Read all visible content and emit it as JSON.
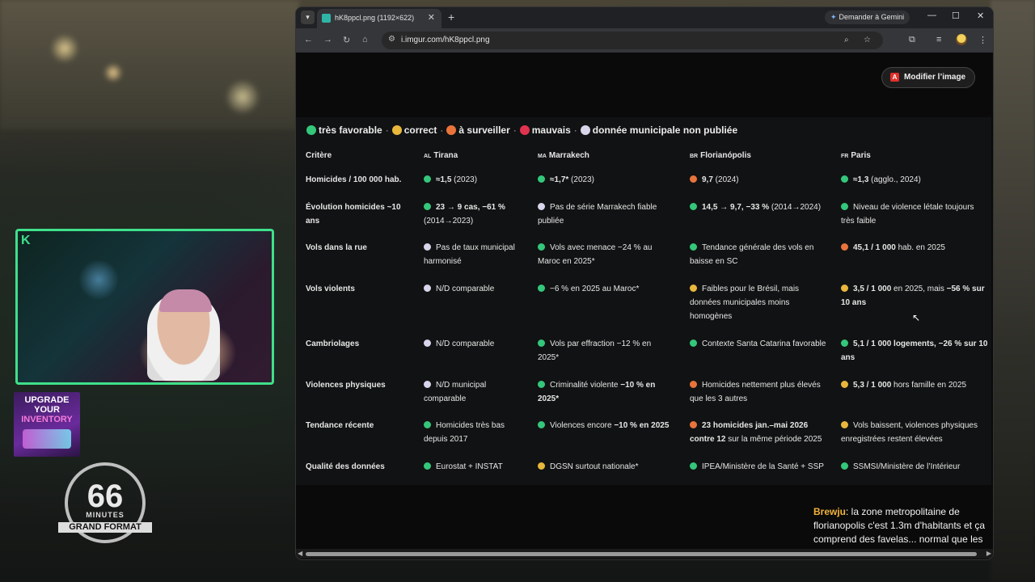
{
  "overlay": {
    "ad": {
      "line1": "UPGRADE",
      "line2": "YOUR",
      "line3": "INVENTORY"
    },
    "logo": {
      "number": "66",
      "minutes": "MINUTES",
      "grand_format": "GRAND FORMAT"
    },
    "webcam_badge": "K"
  },
  "browser": {
    "tab_title": "hK8ppcl.png (1192×622)",
    "tab_close": "✕",
    "new_tab": "+",
    "gemini_label": "Demander à Gemini",
    "url": "i.imgur.com/hK8ppcl.png",
    "window_controls": {
      "minimize": "—",
      "maximize": "☐",
      "close": "✕"
    }
  },
  "page": {
    "edit_button": "Modifier l’image",
    "legend": [
      {
        "label": "très favorable",
        "color": "#34c77b"
      },
      {
        "label": "correct",
        "color": "#e8b73b"
      },
      {
        "label": "à surveiller",
        "color": "#e8743b"
      },
      {
        "label": "mauvais",
        "color": "#e0334e"
      },
      {
        "label": "donnée municipale non publiée",
        "color": "#d8d4ea"
      }
    ],
    "colors": {
      "green": "#34c77b",
      "yellow": "#e8b73b",
      "orange": "#e8743b",
      "red": "#e0334e",
      "grey": "#d8d4ea"
    },
    "table": {
      "headers": [
        {
          "flag": "",
          "label": "Critère"
        },
        {
          "flag": "AL",
          "label": "Tirana"
        },
        {
          "flag": "MA",
          "label": "Marrakech"
        },
        {
          "flag": "BR",
          "label": "Florianópolis"
        },
        {
          "flag": "FR",
          "label": "Paris"
        }
      ],
      "rows": [
        {
          "label": "Homicides / 100 000 hab.",
          "cells": [
            {
              "color": "green",
              "bold": "≈1,5",
              "text": " (2023)"
            },
            {
              "color": "green",
              "bold": "≈1,7*",
              "text": " (2023)"
            },
            {
              "color": "orange",
              "bold": "9,7",
              "text": " (2024)"
            },
            {
              "color": "green",
              "bold": "≈1,3",
              "text": " (agglo., 2024)"
            }
          ]
        },
        {
          "label": "Évolution homicides ~10 ans",
          "cells": [
            {
              "color": "green",
              "bold": "23 → 9 cas, −61 %",
              "text": " (2014→2023)"
            },
            {
              "color": "grey",
              "bold": "",
              "text": "Pas de série Marrakech fiable publiée"
            },
            {
              "color": "green",
              "bold": "14,5 → 9,7, −33 %",
              "text": " (2014→2024)"
            },
            {
              "color": "green",
              "bold": "",
              "text": "Niveau de violence létale toujours très faible"
            }
          ]
        },
        {
          "label": "Vols dans la rue",
          "cells": [
            {
              "color": "grey",
              "bold": "",
              "text": "Pas de taux municipal harmonisé"
            },
            {
              "color": "green",
              "bold": "",
              "text": "Vols avec menace −24 % au Maroc en 2025*"
            },
            {
              "color": "green",
              "bold": "",
              "text": "Tendance générale des vols en baisse en SC"
            },
            {
              "color": "orange",
              "bold": "45,1 / 1 000",
              "text": " hab. en 2025"
            }
          ]
        },
        {
          "label": "Vols violents",
          "cells": [
            {
              "color": "grey",
              "bold": "",
              "text": "N/D comparable"
            },
            {
              "color": "green",
              "bold": "",
              "text": "−6 % en 2025 au Maroc*"
            },
            {
              "color": "yellow",
              "bold": "",
              "text": "Faibles pour le Brésil, mais données municipales moins homogènes"
            },
            {
              "color": "yellow",
              "bold": "3,5 / 1 000",
              "text": " en 2025, mais ",
              "bold2": "−56 % sur 10 ans"
            }
          ]
        },
        {
          "label": "Cambriolages",
          "cells": [
            {
              "color": "grey",
              "bold": "",
              "text": "N/D comparable"
            },
            {
              "color": "green",
              "bold": "",
              "text": "Vols par effraction −12 % en 2025*"
            },
            {
              "color": "green",
              "bold": "",
              "text": "Contexte Santa Catarina favorable"
            },
            {
              "color": "green",
              "bold": "5,1 / 1 000 logements, −26 % sur 10 ans",
              "text": ""
            }
          ]
        },
        {
          "label": "Violences physiques",
          "cells": [
            {
              "color": "grey",
              "bold": "",
              "text": "N/D municipal comparable"
            },
            {
              "color": "green",
              "bold": "",
              "text": "Criminalité violente ",
              "bold2": "−10 % en 2025*"
            },
            {
              "color": "orange",
              "bold": "",
              "text": "Homicides nettement plus élevés que les 3 autres"
            },
            {
              "color": "yellow",
              "bold": "5,3 / 1 000",
              "text": " hors famille en 2025"
            }
          ]
        },
        {
          "label": "Tendance récente",
          "cells": [
            {
              "color": "green",
              "bold": "",
              "text": "Homicides très bas depuis 2017"
            },
            {
              "color": "green",
              "bold": "",
              "text": "Violences encore ",
              "bold2": "−10 % en 2025"
            },
            {
              "color": "orange",
              "bold": "23 homicides jan.–mai 2026 contre 12",
              "text": " sur la même période 2025"
            },
            {
              "color": "yellow",
              "bold": "",
              "text": "Vols baissent, violences physiques enregistrées restent élevées"
            }
          ]
        },
        {
          "label": "Qualité des données",
          "cells": [
            {
              "color": "green",
              "bold": "",
              "text": "Eurostat + INSTAT"
            },
            {
              "color": "yellow",
              "bold": "",
              "text": "DGSN surtout nationale*"
            },
            {
              "color": "green",
              "bold": "",
              "text": "IPEA/Ministère de la Santé + SSP"
            },
            {
              "color": "green",
              "bold": "",
              "text": "SSMSI/Ministère de l’Intérieur"
            }
          ]
        }
      ]
    }
  },
  "chat": {
    "user": "Brewju",
    "message": ": la zone metropolitaine de florianopolis c'est 1.3m d'habitants et ça comprend des favelas... normal que les stats soient boosté"
  }
}
